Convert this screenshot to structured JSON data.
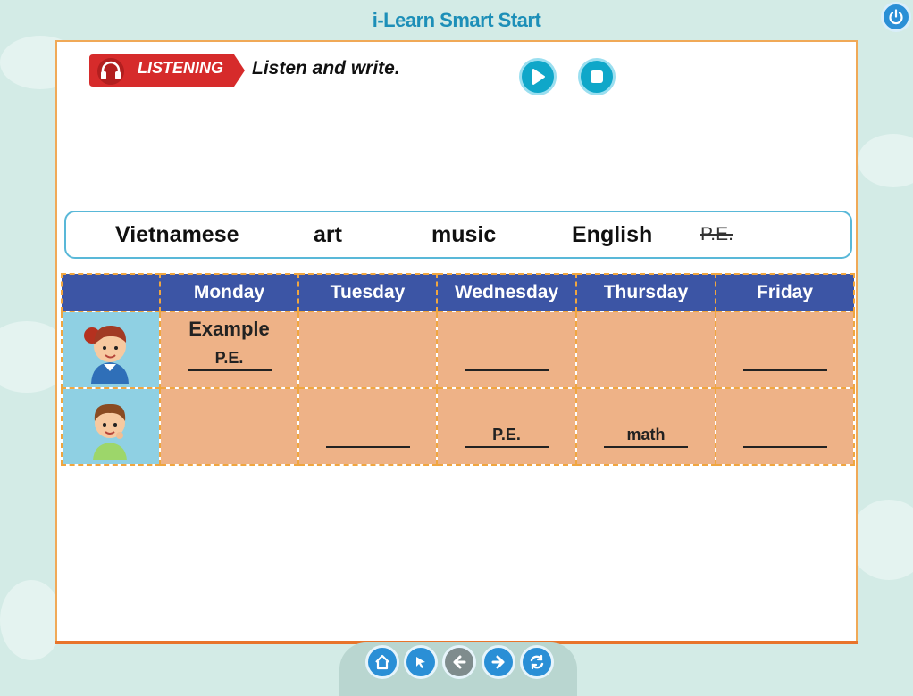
{
  "app": {
    "title": "i-Learn Smart Start"
  },
  "activity": {
    "badge_label": "LISTENING",
    "instruction": "Listen and write."
  },
  "word_bank": [
    {
      "text": "Vietnamese",
      "struck": false
    },
    {
      "text": "art",
      "struck": false
    },
    {
      "text": "music",
      "struck": false
    },
    {
      "text": "English",
      "struck": false
    },
    {
      "text": "P.E.",
      "struck": true
    }
  ],
  "table": {
    "headers": [
      "",
      "Monday",
      "Tuesday",
      "Wednesday",
      "Thursday",
      "Friday"
    ],
    "rows": [
      {
        "child": "girl",
        "example_label": "Example",
        "cells": [
          "P.E.",
          null,
          "",
          null,
          ""
        ]
      },
      {
        "child": "boy",
        "example_label": "",
        "cells": [
          null,
          "",
          "P.E.",
          "math",
          ""
        ]
      }
    ]
  },
  "nav": {
    "buttons": [
      "home-icon",
      "pointer-icon",
      "arrow-left-icon",
      "arrow-right-icon",
      "refresh-icon"
    ]
  },
  "colors": {
    "header_blue": "#3c55a5",
    "cell_orange": "#eeb287",
    "accent_teal": "#0fa7c9",
    "badge_red": "#d62b2b",
    "panel_border": "#f0a957"
  }
}
